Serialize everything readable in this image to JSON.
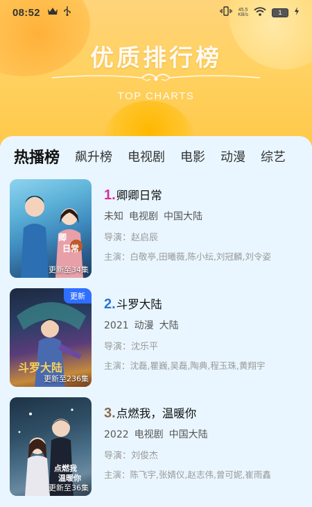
{
  "status_bar": {
    "time": "08:52",
    "net_speed_value": "45.5",
    "net_speed_unit": "KB/s",
    "battery": "1",
    "icons": [
      "crown-icon",
      "usb-icon",
      "vibrate-icon",
      "wifi-icon",
      "battery-icon",
      "charging-icon"
    ]
  },
  "banner": {
    "title": "优质排行榜",
    "subtitle": "TOP CHARTS"
  },
  "tabs": [
    {
      "label": "热播榜",
      "active": true
    },
    {
      "label": "飙升榜",
      "active": false
    },
    {
      "label": "电视剧",
      "active": false
    },
    {
      "label": "电影",
      "active": false
    },
    {
      "label": "动漫",
      "active": false
    },
    {
      "label": "综艺",
      "active": false
    }
  ],
  "items": [
    {
      "rank": "1.",
      "rank_color": "#d62ca0",
      "title": "卿卿日常",
      "year": "未知",
      "category": "电视剧",
      "region": "中国大陆",
      "director": "导演：赵启辰",
      "cast": "主演：白敬亭,田曦薇,陈小纭,刘冠麟,刘令姿",
      "poster_caption": "更新至34集",
      "poster_badge": ""
    },
    {
      "rank": "2.",
      "rank_color": "#2a72d8",
      "title": "斗罗大陆",
      "year": "2021",
      "category": "动漫",
      "region": "大陆",
      "director": "导演：沈乐平",
      "cast": "主演：沈磊,瞿巍,吴磊,陶典,程玉珠,黄翔宇",
      "poster_caption": "更新至236集",
      "poster_badge": "更新"
    },
    {
      "rank": "3.",
      "rank_color": "#8a6a4a",
      "title": "点燃我，温暖你",
      "year": "2022",
      "category": "电视剧",
      "region": "中国大陆",
      "director": "导演：刘俊杰",
      "cast": "主演：陈飞宇,张婧仪,赵志伟,曾可妮,崔雨鑫",
      "poster_caption": "更新至36集",
      "poster_badge": ""
    }
  ]
}
